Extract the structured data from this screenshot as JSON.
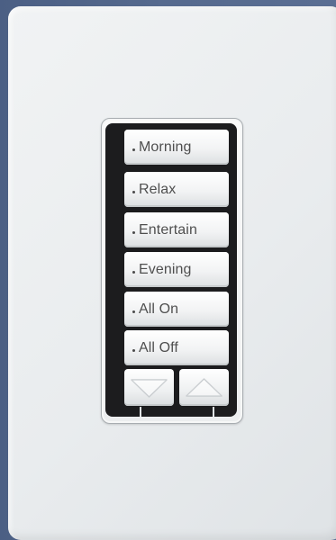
{
  "keypad": {
    "buttons": [
      {
        "label": "Morning"
      },
      {
        "label": "Relax"
      },
      {
        "label": "Entertain"
      },
      {
        "label": "Evening"
      },
      {
        "label": "All On"
      },
      {
        "label": "All Off"
      }
    ],
    "rocker": {
      "lower_icon": "triangle-down-icon",
      "raise_icon": "triangle-up-icon"
    },
    "colors": {
      "wall": "#52668b",
      "plate": "#eceff1",
      "frame": "#1c1c1e",
      "button_text": "#4f4f4f"
    }
  }
}
